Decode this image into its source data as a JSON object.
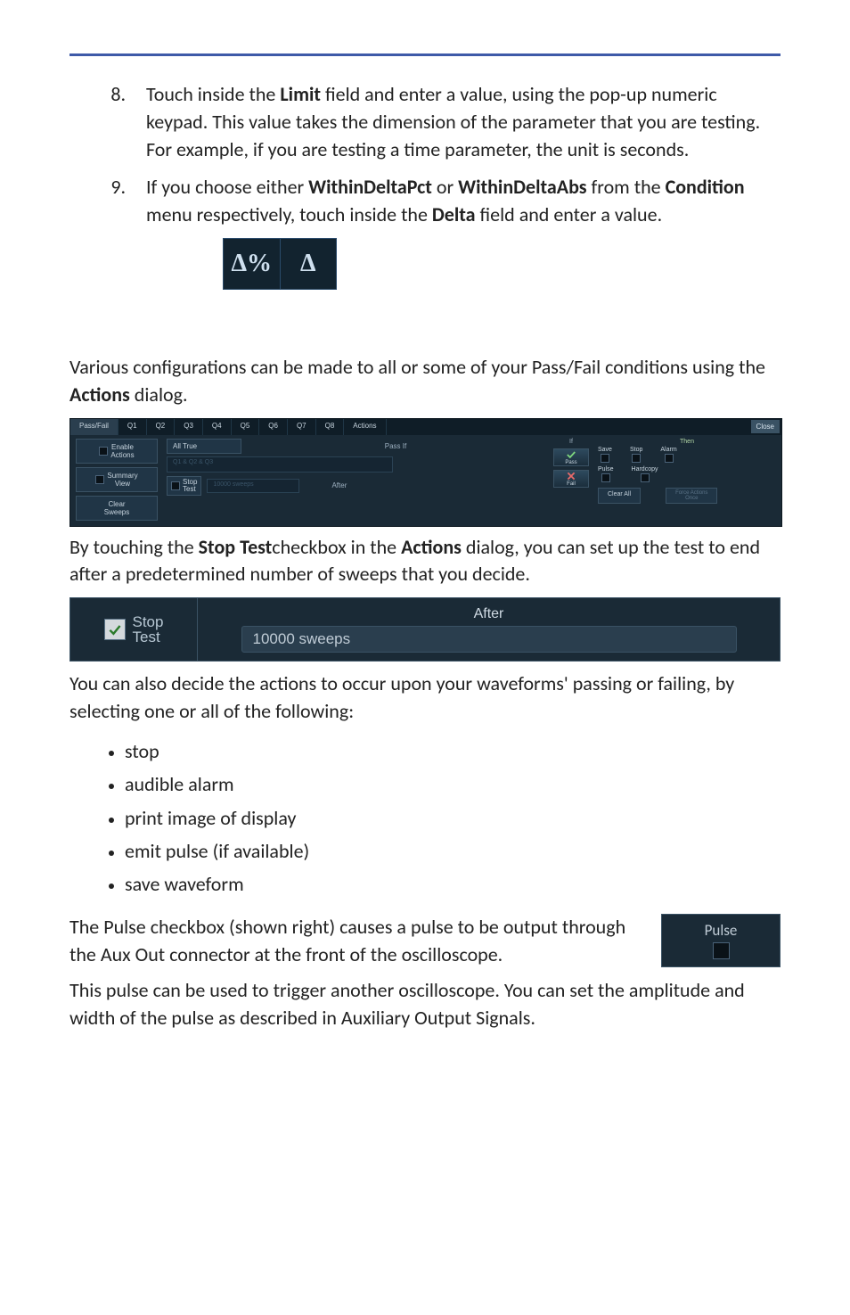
{
  "list": {
    "start": 8,
    "item8": {
      "pre": "Touch inside the ",
      "b1": "Limit",
      "post": " field and enter a value, using the pop-up numeric keypad. This value takes the dimension of the parameter that you are testing. For example, if you are testing a time parameter, the unit is seconds."
    },
    "item9": {
      "pre": "If you choose either ",
      "b1": "WithinDeltaPct",
      "mid1": " or ",
      "b2": "WithinDeltaAbs",
      "mid2": " from the ",
      "b3": "Condition",
      "mid3": " menu respectively, touch inside the ",
      "b4": "Delta",
      "post": " field and enter a value."
    }
  },
  "delta": {
    "left": "Δ%",
    "right": "Δ"
  },
  "para1": {
    "pre": "Various configurations can be made to all or some of your Pass/Fail conditions using the ",
    "b1": "Actions",
    "post": " dialog."
  },
  "dialog": {
    "tabs": {
      "passfail": "Pass/Fail",
      "q1": "Q1",
      "q2": "Q2",
      "q3": "Q3",
      "q4": "Q4",
      "q5": "Q5",
      "q6": "Q6",
      "q7": "Q7",
      "q8": "Q8",
      "actions": "Actions",
      "close": "Close"
    },
    "left": {
      "enable": "Enable\nActions",
      "summary": "Summary\nView",
      "clear": "Clear\nSweeps"
    },
    "mid": {
      "passif": "Pass If",
      "alltrue": "All True",
      "expr": "Q1 & Q2 & Q3",
      "stoptest": "Stop\nTest",
      "after": "After",
      "sweeps": "10000 sweeps"
    },
    "ind": {
      "if": "If",
      "pass": "Pass",
      "fail": "Fail"
    },
    "right": {
      "then": "Then",
      "save": "Save",
      "stop": "Stop",
      "alarm": "Alarm",
      "pulse": "Pulse",
      "hardcopy": "Hardcopy",
      "clearall": "Clear All",
      "force": "Force Actions\nOnce"
    }
  },
  "para2": {
    "pre": "By touching the ",
    "b1": "Stop Test",
    "mid1": "checkbox in the ",
    "b2": "Actions",
    "post": " dialog, you can set up the test to end after a predetermined number of sweeps that you decide."
  },
  "stopbar": {
    "label": "Stop\nTest",
    "check": "✓",
    "after": "After",
    "value": "10000 sweeps"
  },
  "para3": "You can also decide the actions to occur upon your waveforms' passing or failing, by selecting one or all of the following:",
  "bullets": {
    "b1": "stop",
    "b2": "audible alarm",
    "b3": "print image of display",
    "b4": "emit pulse (if available)",
    "b5": "save waveform"
  },
  "pulsepara": "The Pulse checkbox (shown right) causes a pulse to be output through the Aux Out connector at the front of the oscilloscope.",
  "pulsebox": {
    "label": "Pulse"
  },
  "para4": "This pulse can be used to trigger another oscilloscope. You can set the amplitude and width of the pulse as described in Auxiliary Output Signals."
}
